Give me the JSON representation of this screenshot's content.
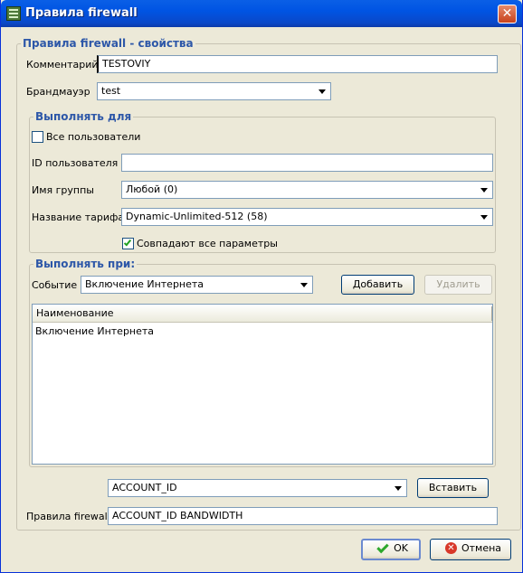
{
  "window": {
    "title": "Правила firewall"
  },
  "properties_group": {
    "legend": "Правила firewall - свойства",
    "comment_label": "Комментарий",
    "comment_value": "TESTOVIY",
    "firewall_label": "Брандмауэр",
    "firewall_value": "test"
  },
  "execute_for": {
    "legend": "Выполнять для",
    "all_users_label": "Все пользователи",
    "all_users_checked": false,
    "user_id_label": "ID пользователя",
    "user_id_value": "",
    "group_label": "Имя группы",
    "group_value": "Любой (0)",
    "tariff_label": "Название тарифа",
    "tariff_value": "Dynamic-Unlimited-512 (58)",
    "match_all_label": "Совпадают все параметры",
    "match_all_checked": true
  },
  "execute_when": {
    "legend": "Выполнять при:",
    "event_label": "Событие",
    "event_value": "Включение Интернета",
    "add_button": "Добавить",
    "delete_button": "Удалить",
    "table": {
      "columns": [
        "Наименование"
      ],
      "rows": [
        [
          "Включение Интернета"
        ]
      ]
    }
  },
  "insert_row": {
    "variable_value": "ACCOUNT_ID",
    "insert_button": "Вставить"
  },
  "rules": {
    "label": "Правила firewall",
    "value": "ACCOUNT_ID BANDWIDTH"
  },
  "footer": {
    "ok_button": "OK",
    "cancel_button": "Отмена"
  },
  "icons": {
    "app": "firewall-app-icon",
    "close": "close-icon",
    "ok": "checkmark-icon",
    "cancel": "cancel-icon"
  }
}
